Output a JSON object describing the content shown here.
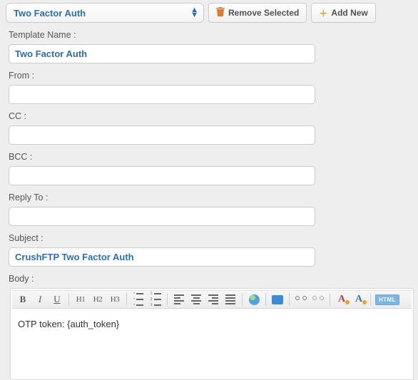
{
  "topbar": {
    "template_select_value": "Two Factor Auth",
    "remove_label": "Remove Selected",
    "add_label": "Add New"
  },
  "fields": {
    "template_name": {
      "label": "Template Name :",
      "value": "Two Factor Auth"
    },
    "from": {
      "label": "From :",
      "value": ""
    },
    "cc": {
      "label": "CC :",
      "value": ""
    },
    "bcc": {
      "label": "BCC :",
      "value": ""
    },
    "reply_to": {
      "label": "Reply To :",
      "value": ""
    },
    "subject": {
      "label": "Subject :",
      "value": "CrushFTP Two Factor Auth"
    },
    "body_label": "Body :"
  },
  "editor": {
    "content": "OTP token: {auth_token}",
    "toolbar": {
      "bold": "B",
      "italic": "I",
      "underline": "U",
      "h1": "H1",
      "h2": "H2",
      "h3": "H3",
      "html": "HTML",
      "a": "A"
    }
  }
}
